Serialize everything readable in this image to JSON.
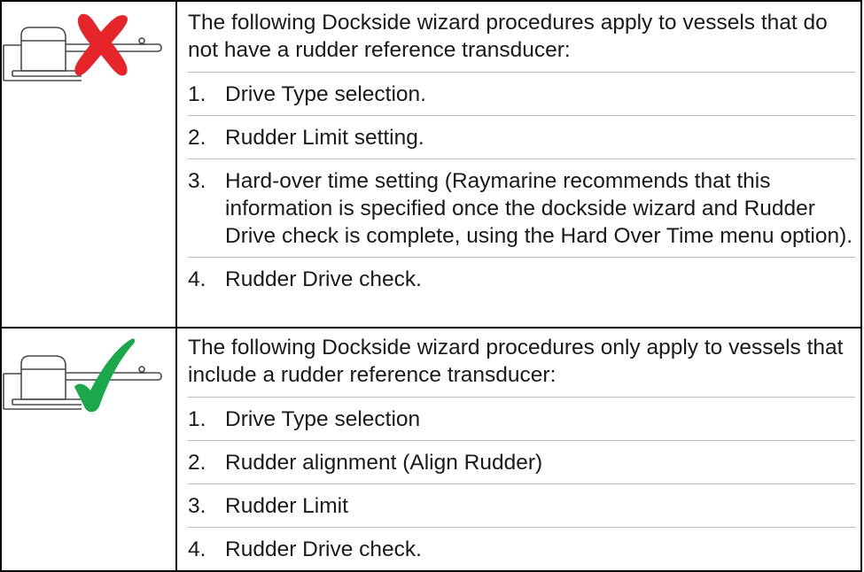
{
  "sections": [
    {
      "status": "not-applicable",
      "icon": "rudder-transducer-crossed-icon",
      "status_color": "#e5252a",
      "intro": "The following Dockside wizard procedures apply to vessels that do not have a rudder reference transducer:",
      "steps": [
        {
          "number": "1.",
          "text": "Drive Type selection."
        },
        {
          "number": "2.",
          "text": "Rudder Limit setting."
        },
        {
          "number": "3.",
          "text": "Hard-over time setting (Raymarine recommends that this information is specified once the dockside wizard and Rudder Drive check is complete, using the Hard Over Time menu option)."
        },
        {
          "number": "4.",
          "text": "Rudder Drive check."
        }
      ]
    },
    {
      "status": "applicable",
      "icon": "rudder-transducer-checked-icon",
      "status_color": "#1aa84a",
      "intro": "The following Dockside wizard procedures only apply to vessels that include a rudder reference transducer:",
      "steps": [
        {
          "number": "1.",
          "text": "Drive Type selection"
        },
        {
          "number": "2.",
          "text": "Rudder alignment (Align Rudder)"
        },
        {
          "number": "3.",
          "text": "Rudder Limit"
        },
        {
          "number": "4.",
          "text": "Rudder Drive check."
        }
      ]
    }
  ]
}
